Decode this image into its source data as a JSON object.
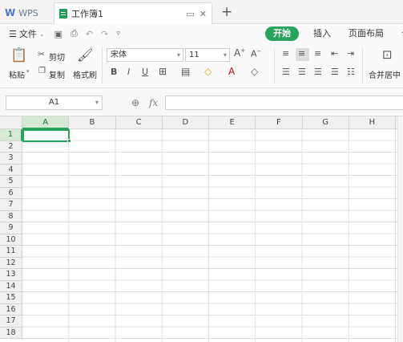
{
  "tabs": {
    "app_label": "WPS",
    "doc_title": "工作簿1",
    "tab_tools": [
      "▭",
      "✕"
    ],
    "new_tab": "+"
  },
  "menu": {
    "file_label": "文件",
    "tabs": [
      {
        "label": "开始",
        "active": true
      },
      {
        "label": "插入",
        "active": false
      },
      {
        "label": "页面布局",
        "active": false
      },
      {
        "label": "公",
        "active": false
      }
    ]
  },
  "ribbon": {
    "paste_label": "粘贴",
    "cut_label": "剪切",
    "copy_label": "复制",
    "format_painter_label": "格式刷",
    "font_name": "宋体",
    "font_size": "11",
    "merge_label": "合并居中"
  },
  "formula_bar": {
    "cell_ref": "A1",
    "fx_label": "fx",
    "formula_value": ""
  },
  "grid": {
    "columns": [
      "A",
      "B",
      "C",
      "D",
      "E",
      "F",
      "G",
      "H"
    ],
    "rows": [
      "1",
      "2",
      "3",
      "4",
      "5",
      "6",
      "7",
      "8",
      "9",
      "10",
      "11",
      "12",
      "13",
      "14",
      "15",
      "16",
      "17",
      "18"
    ],
    "selected_column": "A",
    "selected_row": "1"
  },
  "colors": {
    "accent": "#26a55a",
    "wps_blue": "#4c74d6",
    "header_bg": "#f0f0f0"
  }
}
